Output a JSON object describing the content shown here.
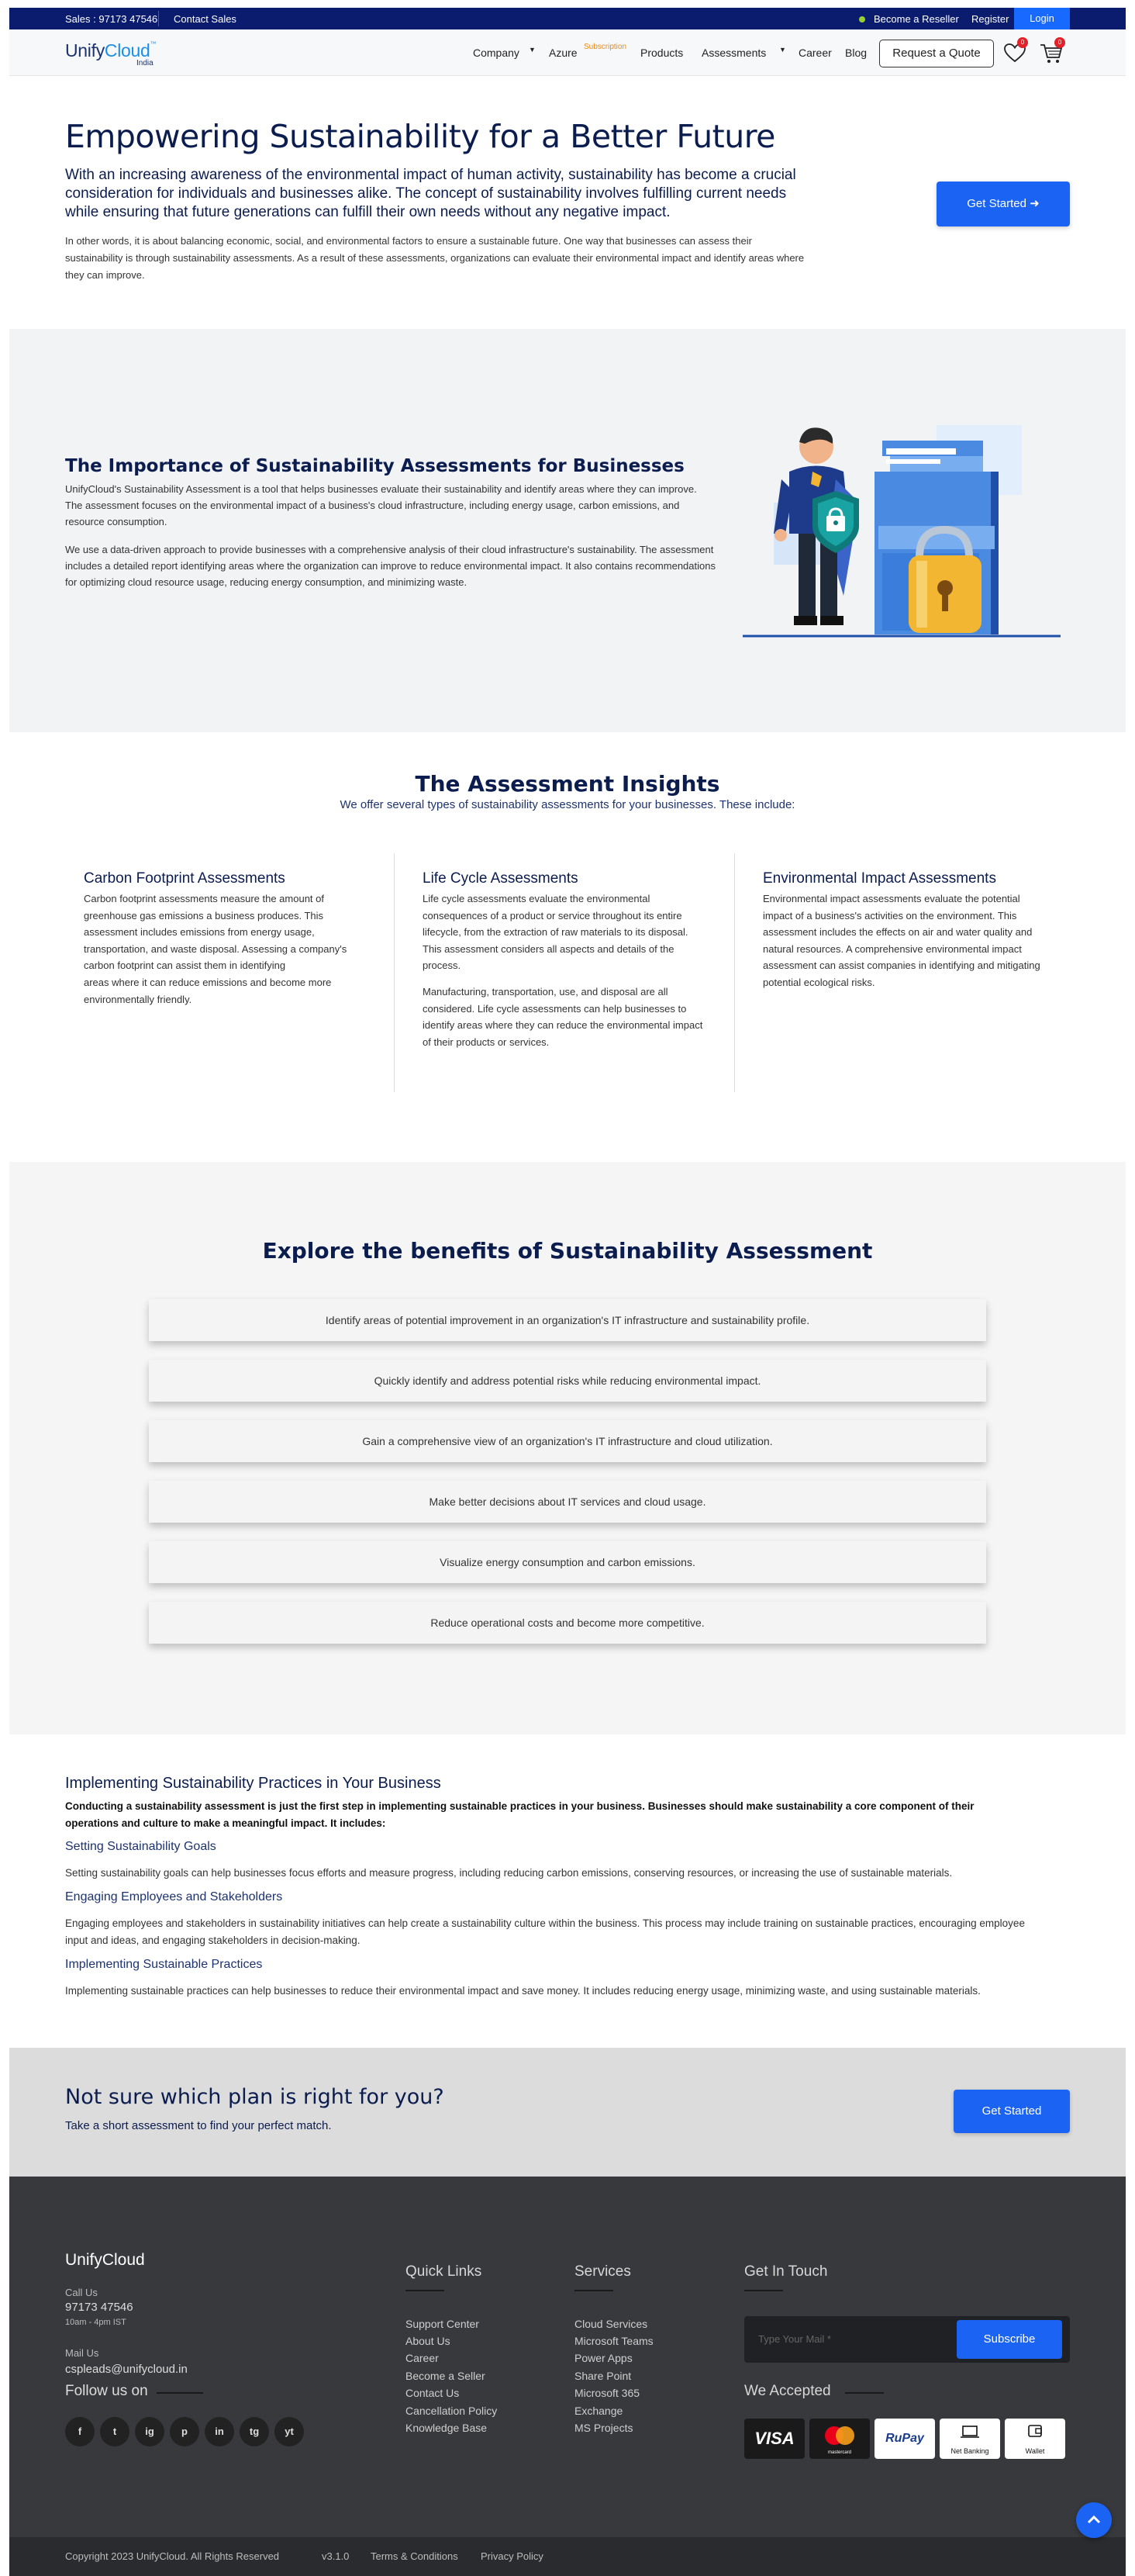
{
  "topbar": {
    "sales": "Sales : 97173 47546",
    "contact_sales": "Contact Sales",
    "become_reseller": "Become a Reseller",
    "register": "Register",
    "login": "Login"
  },
  "header": {
    "logo_main": "Unify",
    "logo_accent": "Cloud",
    "logo_tm": "™",
    "logo_region": "India",
    "nav": {
      "company": "Company",
      "azure": "Azure",
      "azure_badge": "Subscription",
      "products": "Products",
      "assessments": "Assessments",
      "career": "Career",
      "blog": "Blog"
    },
    "request_quote": "Request a Quote",
    "wishlist_count": "0",
    "cart_count": "0"
  },
  "hero": {
    "title": "Empowering Sustainability for a Better Future",
    "lead": "With an increasing awareness of the environmental impact of human activity, sustainability has become a crucial consideration for individuals and businesses alike. The concept of sustainability involves fulfilling current needs while ensuring that future generations can fulfill their own needs without any negative impact.",
    "body": "In other words, it is about balancing economic, social, and environmental factors to ensure a sustainable future. One way that businesses can assess their sustainability is through sustainability assessments. As a result of these assessments, organizations can evaluate their environmental impact and identify areas where they can improve.",
    "cta": "Get Started"
  },
  "importance": {
    "title": "The Importance of Sustainability Assessments for Businesses",
    "p1": "UnifyCloud's Sustainability Assessment is a tool that helps businesses evaluate their sustainability and identify areas where they can improve. The assessment focuses on the environmental impact of a business's cloud infrastructure, including energy usage, carbon emissions, and resource consumption.",
    "p2": "We use a data-driven approach to provide businesses with a comprehensive analysis of their cloud infrastructure's sustainability. The assessment includes a detailed report identifying areas where the organization can improve to reduce environmental impact. It also contains recommendations for optimizing cloud resource usage, reducing energy consumption, and minimizing waste."
  },
  "insights": {
    "title": "The Assessment Insights",
    "subtitle": "We offer several types of sustainability assessments for your businesses. These include:",
    "cards": [
      {
        "title": "Carbon Footprint Assessments",
        "p1": "Carbon footprint assessments measure the amount of greenhouse gas emissions a business produces. This assessment includes emissions from energy usage, transportation, and waste disposal. Assessing a company's carbon footprint can assist them in identifying",
        "p2": "areas where it can reduce emissions and become more environmentally friendly."
      },
      {
        "title": "Life Cycle Assessments",
        "p1": "Life cycle assessments evaluate the environmental consequences of a product or service throughout its entire lifecycle, from the extraction of raw materials to its disposal. This assessment considers all aspects and details of the process.",
        "p2": "Manufacturing, transportation, use, and disposal are all considered. Life cycle assessments can help businesses to identify areas where they can reduce the environmental impact of their products or services."
      },
      {
        "title": "Environmental Impact Assessments",
        "p1": "Environmental impact assessments evaluate the potential impact of a business's activities on the environment. This assessment includes the effects on air and water quality and natural resources. A comprehensive environmental impact assessment can assist companies in identifying and mitigating potential ecological risks.",
        "p2": ""
      }
    ]
  },
  "benefits": {
    "title": "Explore the benefits of Sustainability Assessment",
    "items": [
      "Identify areas of potential improvement in an organization's IT infrastructure and sustainability profile.",
      "Quickly identify and address potential risks while reducing environmental impact.",
      "Gain a comprehensive view of an organization's IT infrastructure and cloud utilization.",
      "Make better decisions about IT services and cloud usage.",
      "Visualize energy consumption and carbon emissions.",
      "Reduce operational costs and become more competitive."
    ]
  },
  "practices": {
    "title": "Implementing Sustainability Practices in Your Business",
    "intro": "Conducting a sustainability assessment is just the first step in implementing sustainable practices in your business. Businesses should make sustainability a core component of their operations and culture to make a meaningful impact. It includes:",
    "items": [
      {
        "heading": "Setting Sustainability Goals",
        "text": "Setting sustainability goals can help businesses focus efforts and measure progress, including reducing carbon emissions, conserving resources, or increasing the use of sustainable materials."
      },
      {
        "heading": "Engaging Employees and Stakeholders",
        "text": "Engaging employees and stakeholders in sustainability initiatives can help create a sustainability culture within the business. This process may include training on sustainable practices, encouraging employee input and ideas, and engaging stakeholders in decision-making."
      },
      {
        "heading": "Implementing Sustainable Practices",
        "text": "Implementing sustainable practices can help businesses to reduce their environmental impact and save money. It includes reducing energy usage, minimizing waste, and using sustainable materials."
      }
    ]
  },
  "cta": {
    "title": "Not sure which plan is right for you?",
    "subtitle": "Take a short assessment to find your perfect match.",
    "button": "Get Started"
  },
  "footer": {
    "logo": "UnifyCloud",
    "call_label": "Call Us",
    "phone": "97173 47546",
    "hours": "10am - 4pm IST",
    "mail_label": "Mail Us",
    "email": "cspleads@unifycloud.in",
    "follow": "Follow us on",
    "social": [
      "f",
      "t",
      "ig",
      "p",
      "in",
      "tg",
      "yt"
    ],
    "quick_links_title": "Quick Links",
    "quick_links": [
      "Support Center",
      "About Us",
      "Career",
      "Become a Seller",
      "Contact Us",
      "Cancellation Policy",
      "Knowledge Base"
    ],
    "services_title": "Services",
    "services": [
      "Cloud Services",
      "Microsoft Teams",
      "Power Apps",
      "Share Point",
      "Microsoft 365",
      "Exchange",
      "MS Projects"
    ],
    "touch_title": "Get In Touch",
    "mail_placeholder": "Type Your Mail *",
    "subscribe": "Subscribe",
    "accepted_title": "We Accepted",
    "payments": [
      "VISA",
      "mastercard",
      "RuPay",
      "Net Banking",
      "Wallet"
    ],
    "copyright": "Copyright 2023 UnifyCloud. All Rights Reserved",
    "version": "v3.1.0",
    "terms": "Terms & Conditions",
    "privacy": "Privacy Policy"
  }
}
